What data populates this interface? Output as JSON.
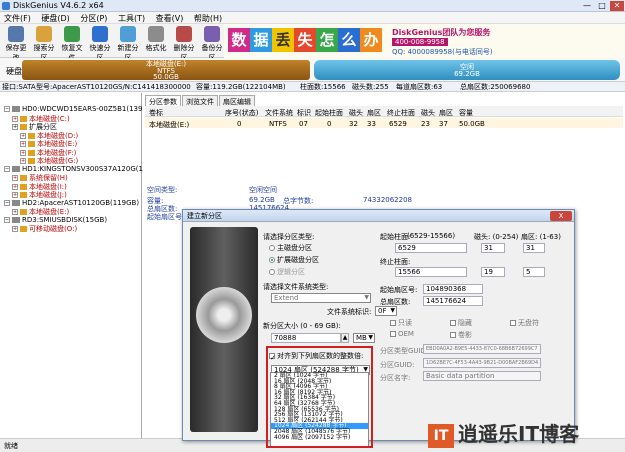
{
  "window": {
    "title": "DiskGenius V4.6.2 x64",
    "min": "—",
    "max": "□",
    "close": "✕"
  },
  "menu": [
    "文件(F)",
    "硬盘(D)",
    "分区(P)",
    "工具(T)",
    "查看(V)",
    "帮助(H)"
  ],
  "toolbar": [
    "保存更改",
    "搜索分区",
    "恢复文件",
    "快速分区",
    "新建分区",
    "格式化",
    "删除分区",
    "备份分区"
  ],
  "banner": {
    "chars": [
      "数",
      "据",
      "丢",
      "失",
      "怎",
      "么",
      "办"
    ],
    "text": "DiskGenius团队为您服务",
    "phone": "400-008-9958",
    "qq": "QQ: 4000089958(与电话同号)"
  },
  "diskbar": {
    "label": "硬盘 2",
    "p1": [
      "本地磁盘(E:)",
      "NTFS",
      "50.0GB"
    ],
    "p2": [
      "空闲",
      "69.2GB"
    ]
  },
  "infobar": {
    "iface": "接口:SATA",
    "model": "型号:ApacerAST10120G",
    "serial": "S/N:C141418300000",
    "capacity": "容量:119.2GB(122104MB)",
    "cyl": "柱面数:15566",
    "heads": "磁头数:255",
    "spt": "每道扇区数:63",
    "total": "总扇区数:250069680"
  },
  "tree": [
    {
      "t": "HD0:WDCWD15EARS-00Z5B1(1397GB)",
      "lvl": 0,
      "k": "disk"
    },
    {
      "t": "本地磁盘(C:)",
      "lvl": 1,
      "k": "part",
      "red": true
    },
    {
      "t": "扩展分区",
      "lvl": 1,
      "k": "part",
      "red": false
    },
    {
      "t": "本地磁盘(D:)",
      "lvl": 2,
      "k": "part",
      "red": true
    },
    {
      "t": "本地磁盘(E:)",
      "lvl": 2,
      "k": "part",
      "red": true
    },
    {
      "t": "本地磁盘(F:)",
      "lvl": 2,
      "k": "part",
      "red": true
    },
    {
      "t": "本地磁盘(G:)",
      "lvl": 2,
      "k": "part",
      "red": true
    },
    {
      "t": "HD1:KINGSTONSV300S37A120G(112GB)",
      "lvl": 0,
      "k": "disk"
    },
    {
      "t": "系统保留(H)",
      "lvl": 1,
      "k": "part",
      "red": true
    },
    {
      "t": "本地磁盘(I:)",
      "lvl": 1,
      "k": "part",
      "red": true
    },
    {
      "t": "本地磁盘(J:)",
      "lvl": 1,
      "k": "part",
      "red": true
    },
    {
      "t": "HD2:ApacerAST10120GB(119GB)",
      "lvl": 0,
      "k": "disk"
    },
    {
      "t": "本地磁盘(E:)",
      "lvl": 1,
      "k": "part",
      "red": true
    },
    {
      "t": "RD3:SMIUSBDISK(15GB)",
      "lvl": 0,
      "k": "disk"
    },
    {
      "t": "可移动磁盘(O:)",
      "lvl": 1,
      "k": "part",
      "red": true
    }
  ],
  "tabs": [
    "分区参数",
    "浏览文件",
    "扇区编辑"
  ],
  "table": {
    "head": [
      "卷标",
      "序号(状态)",
      "文件系统",
      "标识",
      "起始柱面",
      "磁头",
      "扇区",
      "终止柱面",
      "磁头",
      "扇区",
      "容量"
    ],
    "row": [
      "本地磁盘(E:)",
      "0",
      "NTFS",
      "07",
      "0",
      "32",
      "33",
      "6529",
      "23",
      "37",
      "50.0GB"
    ]
  },
  "ptype": {
    "space_label": "空闲空间",
    "type_label": "空间类型:",
    "cap_label": "容量:",
    "cap": "69.2GB",
    "bytes_label": "总字节数:",
    "bytes": "74332062208",
    "sectors_label": "总扇区数:",
    "sectors": "145176624",
    "start_label": "起始扇区号:",
    "start": "104890368"
  },
  "dialog": {
    "title": "建立新分区",
    "close": "X",
    "choose_type": "请选择分区类型:",
    "primary": "主磁盘分区",
    "extended": "扩展磁盘分区",
    "logical": "逻辑分区",
    "fs_label": "请选择文件系统类型:",
    "fs": "Extend",
    "fsid_label": "文件系统标识:",
    "fsid": "0F",
    "size_label": "新分区大小 (0 - 69 GB):",
    "size": "70888",
    "size_unit": "MB",
    "align_label": "对齐到下列扇区数的整数倍:",
    "align_sel": "1024 扇区 (524288 字节)",
    "align_opts": [
      "2 扇区 (1024 字节)",
      "16 扇区 (2048 字节)",
      "8 扇区 (4096 字节)",
      "16 扇区 (8192 字节)",
      "32 扇区 (16384 字节)",
      "64 扇区 (32768 字节)",
      "128 扇区 (65536 字节)",
      "256 扇区 (131072 字节)",
      "512 扇区 (262144 字节)",
      "1024 扇区 (524288 字节)",
      "2048 扇区 (1048576 字节)",
      "4096 扇区 (2097152 字节)"
    ],
    "start_cyl": "起始柱面:",
    "start_cyl_rng": "(6529-15566)",
    "heads_rng": "磁头: (0-254)",
    "sect_rng": "扇区: (1-63)",
    "sc": "6529",
    "sh": "31",
    "ss": "31",
    "end_cyl": "终止柱面:",
    "ec": "15566",
    "eh": "19",
    "es": "5",
    "start_sec_label": "起始扇区号:",
    "start_sec": "104890368",
    "total_sec_label": "总扇区数:",
    "total_sec": "145176624",
    "attrs": [
      "只读",
      "隐藏",
      "无盘符",
      "OEM",
      "卷影"
    ],
    "guid1_label": "分区类型GUID:",
    "guid1": "EBD0A0A2-B9E5-4433-87C0-68B6B72699C7",
    "guid2_label": "分区GUID:",
    "guid2": "1D62BE7C-4F53-4A43-9B21-D00BAF2B69D4",
    "name_label": "分区名字:",
    "name": "Basic data partition"
  },
  "status": "就绪",
  "watermark": {
    "logo": "IT",
    "text": "逍遥乐IT博客"
  }
}
